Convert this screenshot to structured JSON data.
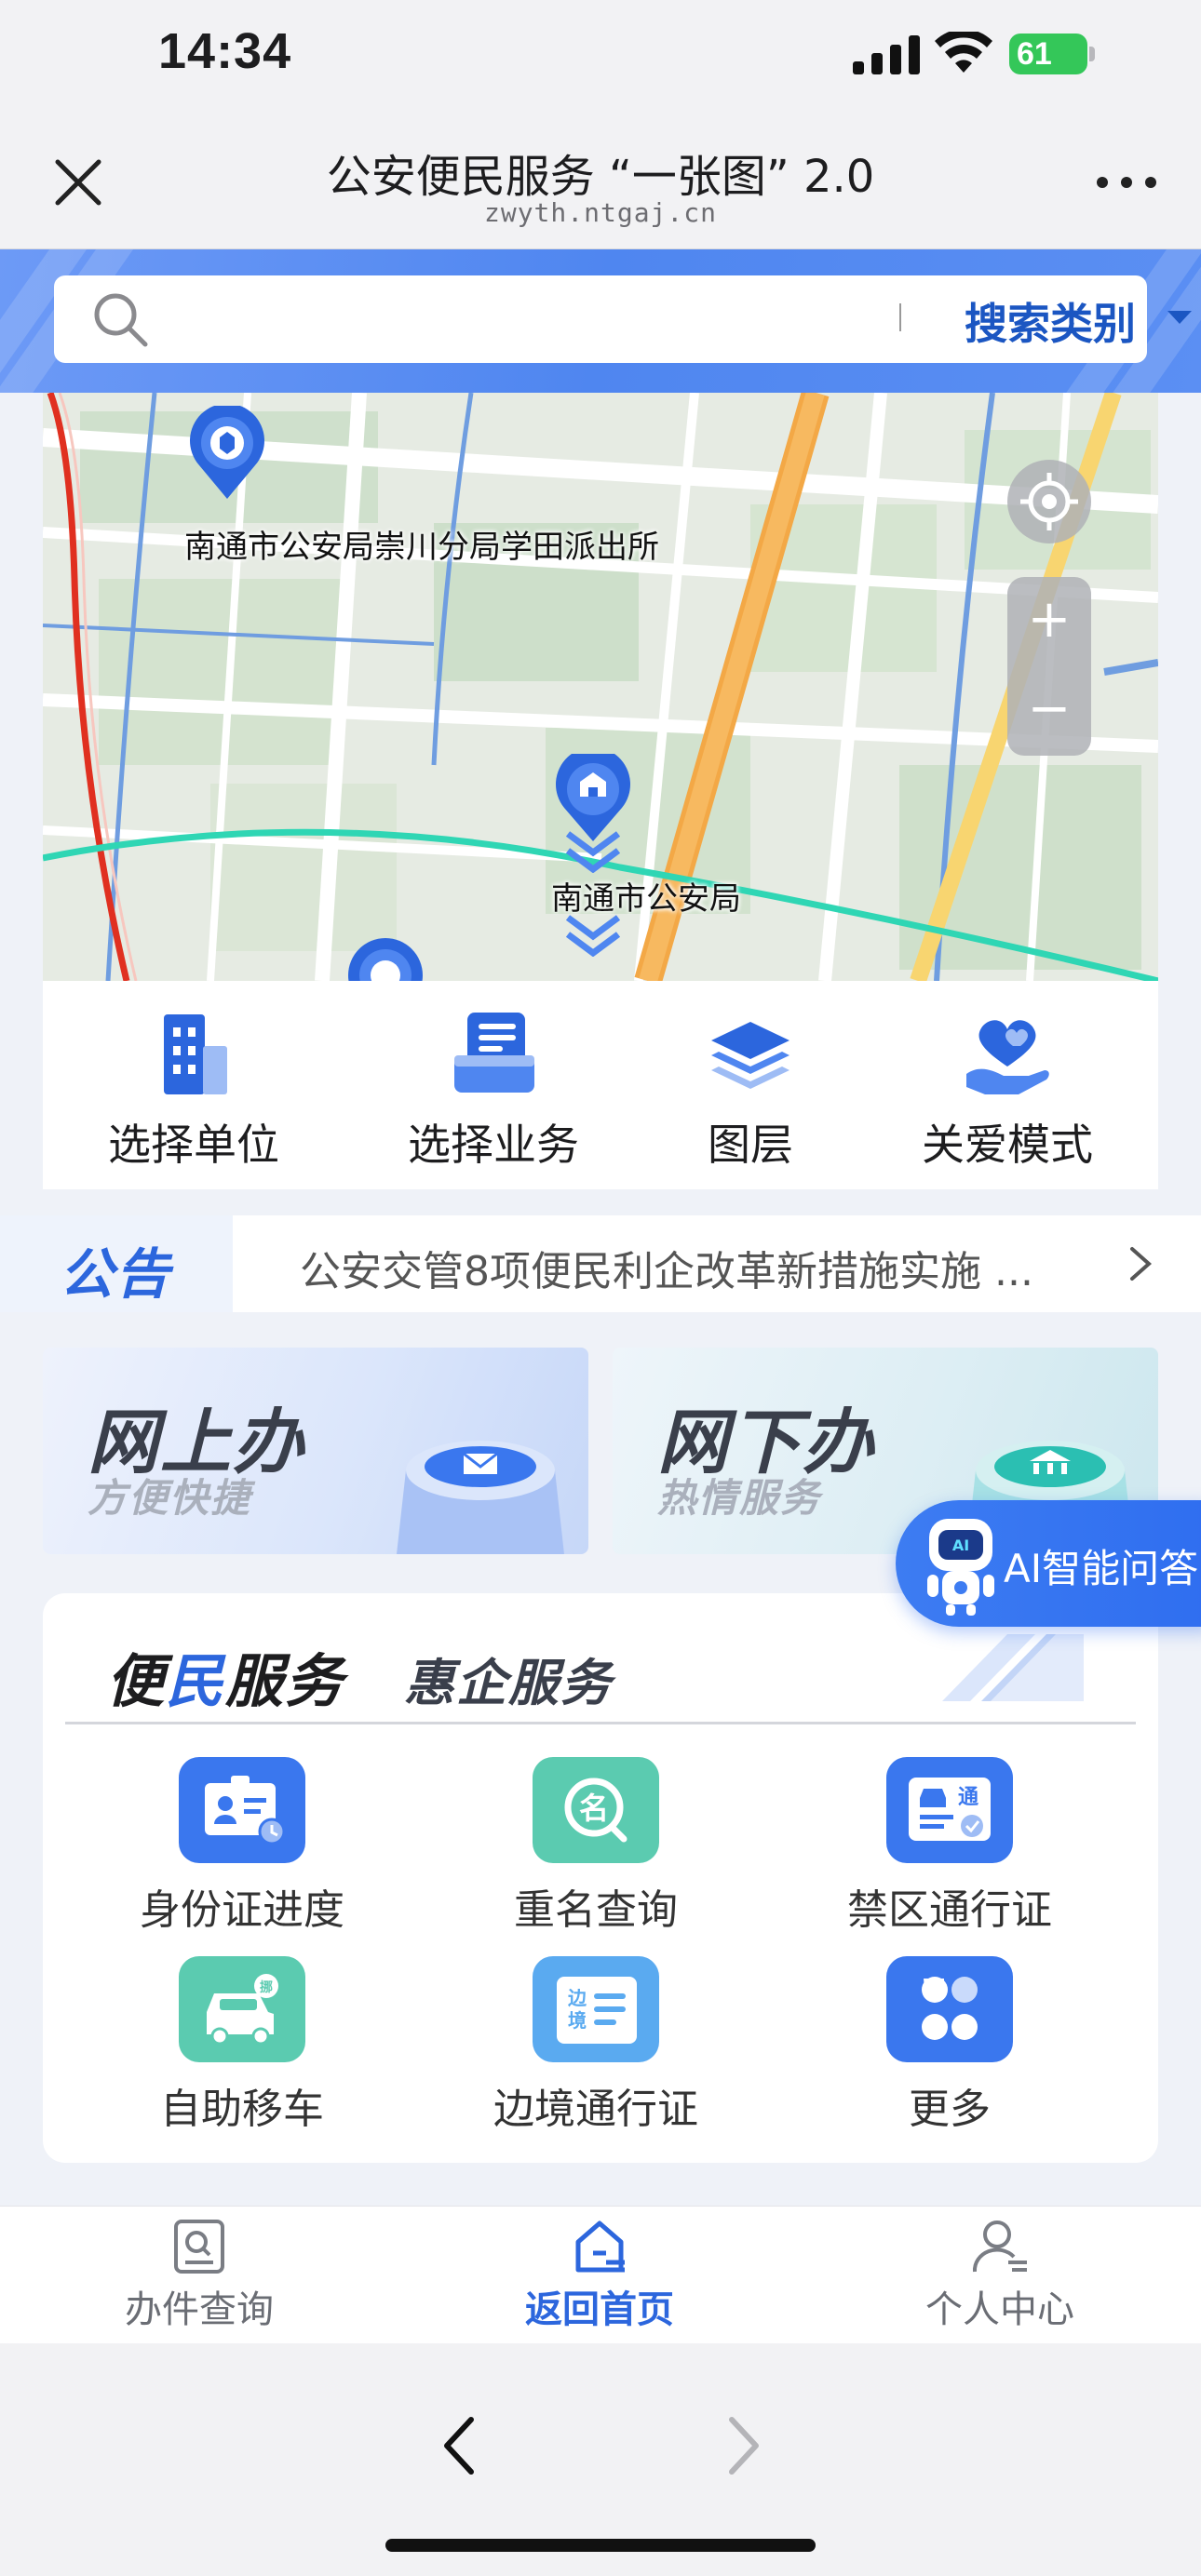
{
  "status_bar": {
    "time": "14:34",
    "battery": "61"
  },
  "header": {
    "title": "公安便民服务 “一张图” 2.0",
    "url": "zwyth.ntgaj.cn"
  },
  "search": {
    "placeholder": "",
    "type_label": "搜索类别"
  },
  "map": {
    "pois": [
      {
        "label": "南通市公安局崇川分局学田派出所"
      },
      {
        "label": "南通市公安局"
      }
    ],
    "zoom_in": "+",
    "zoom_out": "−"
  },
  "actions": [
    {
      "label": "选择单位",
      "icon": "building-icon"
    },
    {
      "label": "选择业务",
      "icon": "business-icon"
    },
    {
      "label": "图层",
      "icon": "layers-icon"
    },
    {
      "label": "关爱模式",
      "icon": "care-heart-icon"
    }
  ],
  "notice": {
    "badge": "公告",
    "text": "公安交管8项便民利企改革新措施实施 ..."
  },
  "cards": {
    "online": {
      "title": "网上办",
      "subtitle": "方便快捷"
    },
    "offline": {
      "title": "网下办",
      "subtitle": "热情服务"
    }
  },
  "ai": {
    "label": "AI智能问答"
  },
  "services": {
    "tab_active_pre": "便",
    "tab_active_hl": "民",
    "tab_active_post": "服务",
    "tab_other": "惠企服务",
    "items": [
      {
        "label": "身份证进度",
        "icon": "id-card-progress-icon",
        "color": "#3a77ee"
      },
      {
        "label": "重名查询",
        "icon": "name-search-icon",
        "color": "#5bcbb0"
      },
      {
        "label": "禁区通行证",
        "icon": "restricted-pass-icon",
        "color": "#3a77ee"
      },
      {
        "label": "自助移车",
        "icon": "move-car-icon",
        "color": "#5bcbb0"
      },
      {
        "label": "边境通行证",
        "icon": "border-pass-icon",
        "color": "#5aaaf0"
      },
      {
        "label": "更多",
        "icon": "more-grid-icon",
        "color": "#3a77ee"
      }
    ]
  },
  "tabbar": [
    {
      "label": "办件查询",
      "icon": "case-query-icon"
    },
    {
      "label": "返回首页",
      "icon": "home-icon",
      "active": true
    },
    {
      "label": "个人中心",
      "icon": "profile-icon"
    }
  ],
  "colors": {
    "accent": "#2c66dd",
    "brand_blue": "#4f86f0",
    "teal": "#5bcbb0"
  }
}
